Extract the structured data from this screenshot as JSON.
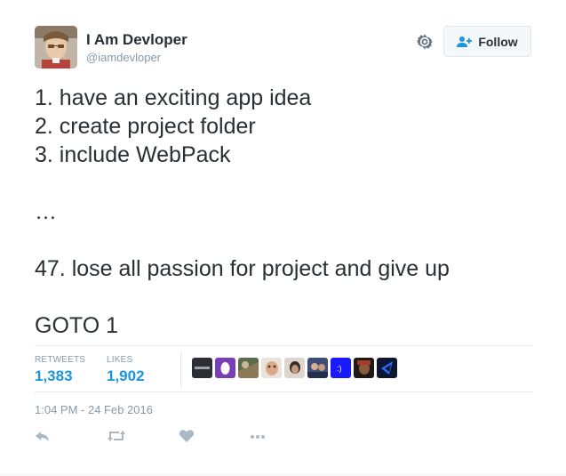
{
  "user": {
    "display_name": "I Am Devloper",
    "handle": "@iamdevloper"
  },
  "follow_button": {
    "label": "Follow"
  },
  "tweet": {
    "lines": [
      "1. have an exciting app idea",
      "2. create project folder",
      "3. include WebPack",
      "",
      "…",
      "",
      "47. lose all passion for project and give up",
      "",
      "GOTO 1"
    ]
  },
  "stats": {
    "retweets_label": "RETWEETS",
    "retweets_value": "1,383",
    "likes_label": "LIKES",
    "likes_value": "1,902"
  },
  "timestamp": "1:04 PM - 24 Feb 2016",
  "colors": {
    "accent": "#1b95e0",
    "text": "#292f33",
    "muted": "#8899a6",
    "icon": "#aab8c2"
  }
}
